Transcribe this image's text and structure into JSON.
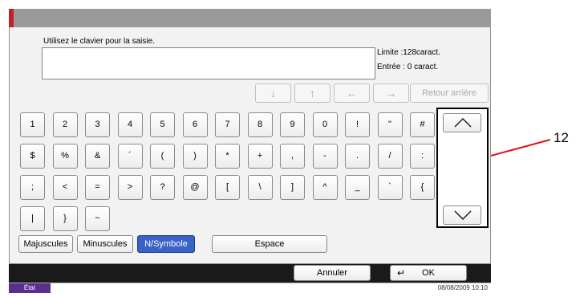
{
  "instruction": "Utilisez le clavier pour la saisie.",
  "limit_text": "Limite :128caract.",
  "entry_text": "Entrée :  0 caract.",
  "nav": {
    "down": "↓",
    "up": "↑",
    "left": "←",
    "right": "→",
    "backspace_label": "Retour arrière"
  },
  "keyboard_rows": [
    [
      "1",
      "2",
      "3",
      "4",
      "5",
      "6",
      "7",
      "8",
      "9",
      "0",
      "!",
      "\"",
      "#"
    ],
    [
      "$",
      "%",
      "&",
      "´",
      "(",
      ")",
      "*",
      "+",
      ",",
      "-",
      ".",
      "/",
      ":"
    ],
    [
      ";",
      "<",
      "=",
      ">",
      "?",
      "@",
      "[",
      "\\",
      "]",
      "^",
      "_",
      "`",
      "{"
    ],
    [
      "|",
      "}",
      "~"
    ]
  ],
  "modes": {
    "uppercase": "Majuscules",
    "lowercase": "Minuscules",
    "number_symbol": "N/Symbole",
    "space": "Espace"
  },
  "footer": {
    "cancel": "Annuler",
    "ok": "OK",
    "ok_icon": "↵",
    "state_label": "État",
    "datetime": "08/08/2009   10:10"
  },
  "callout_label": "12"
}
